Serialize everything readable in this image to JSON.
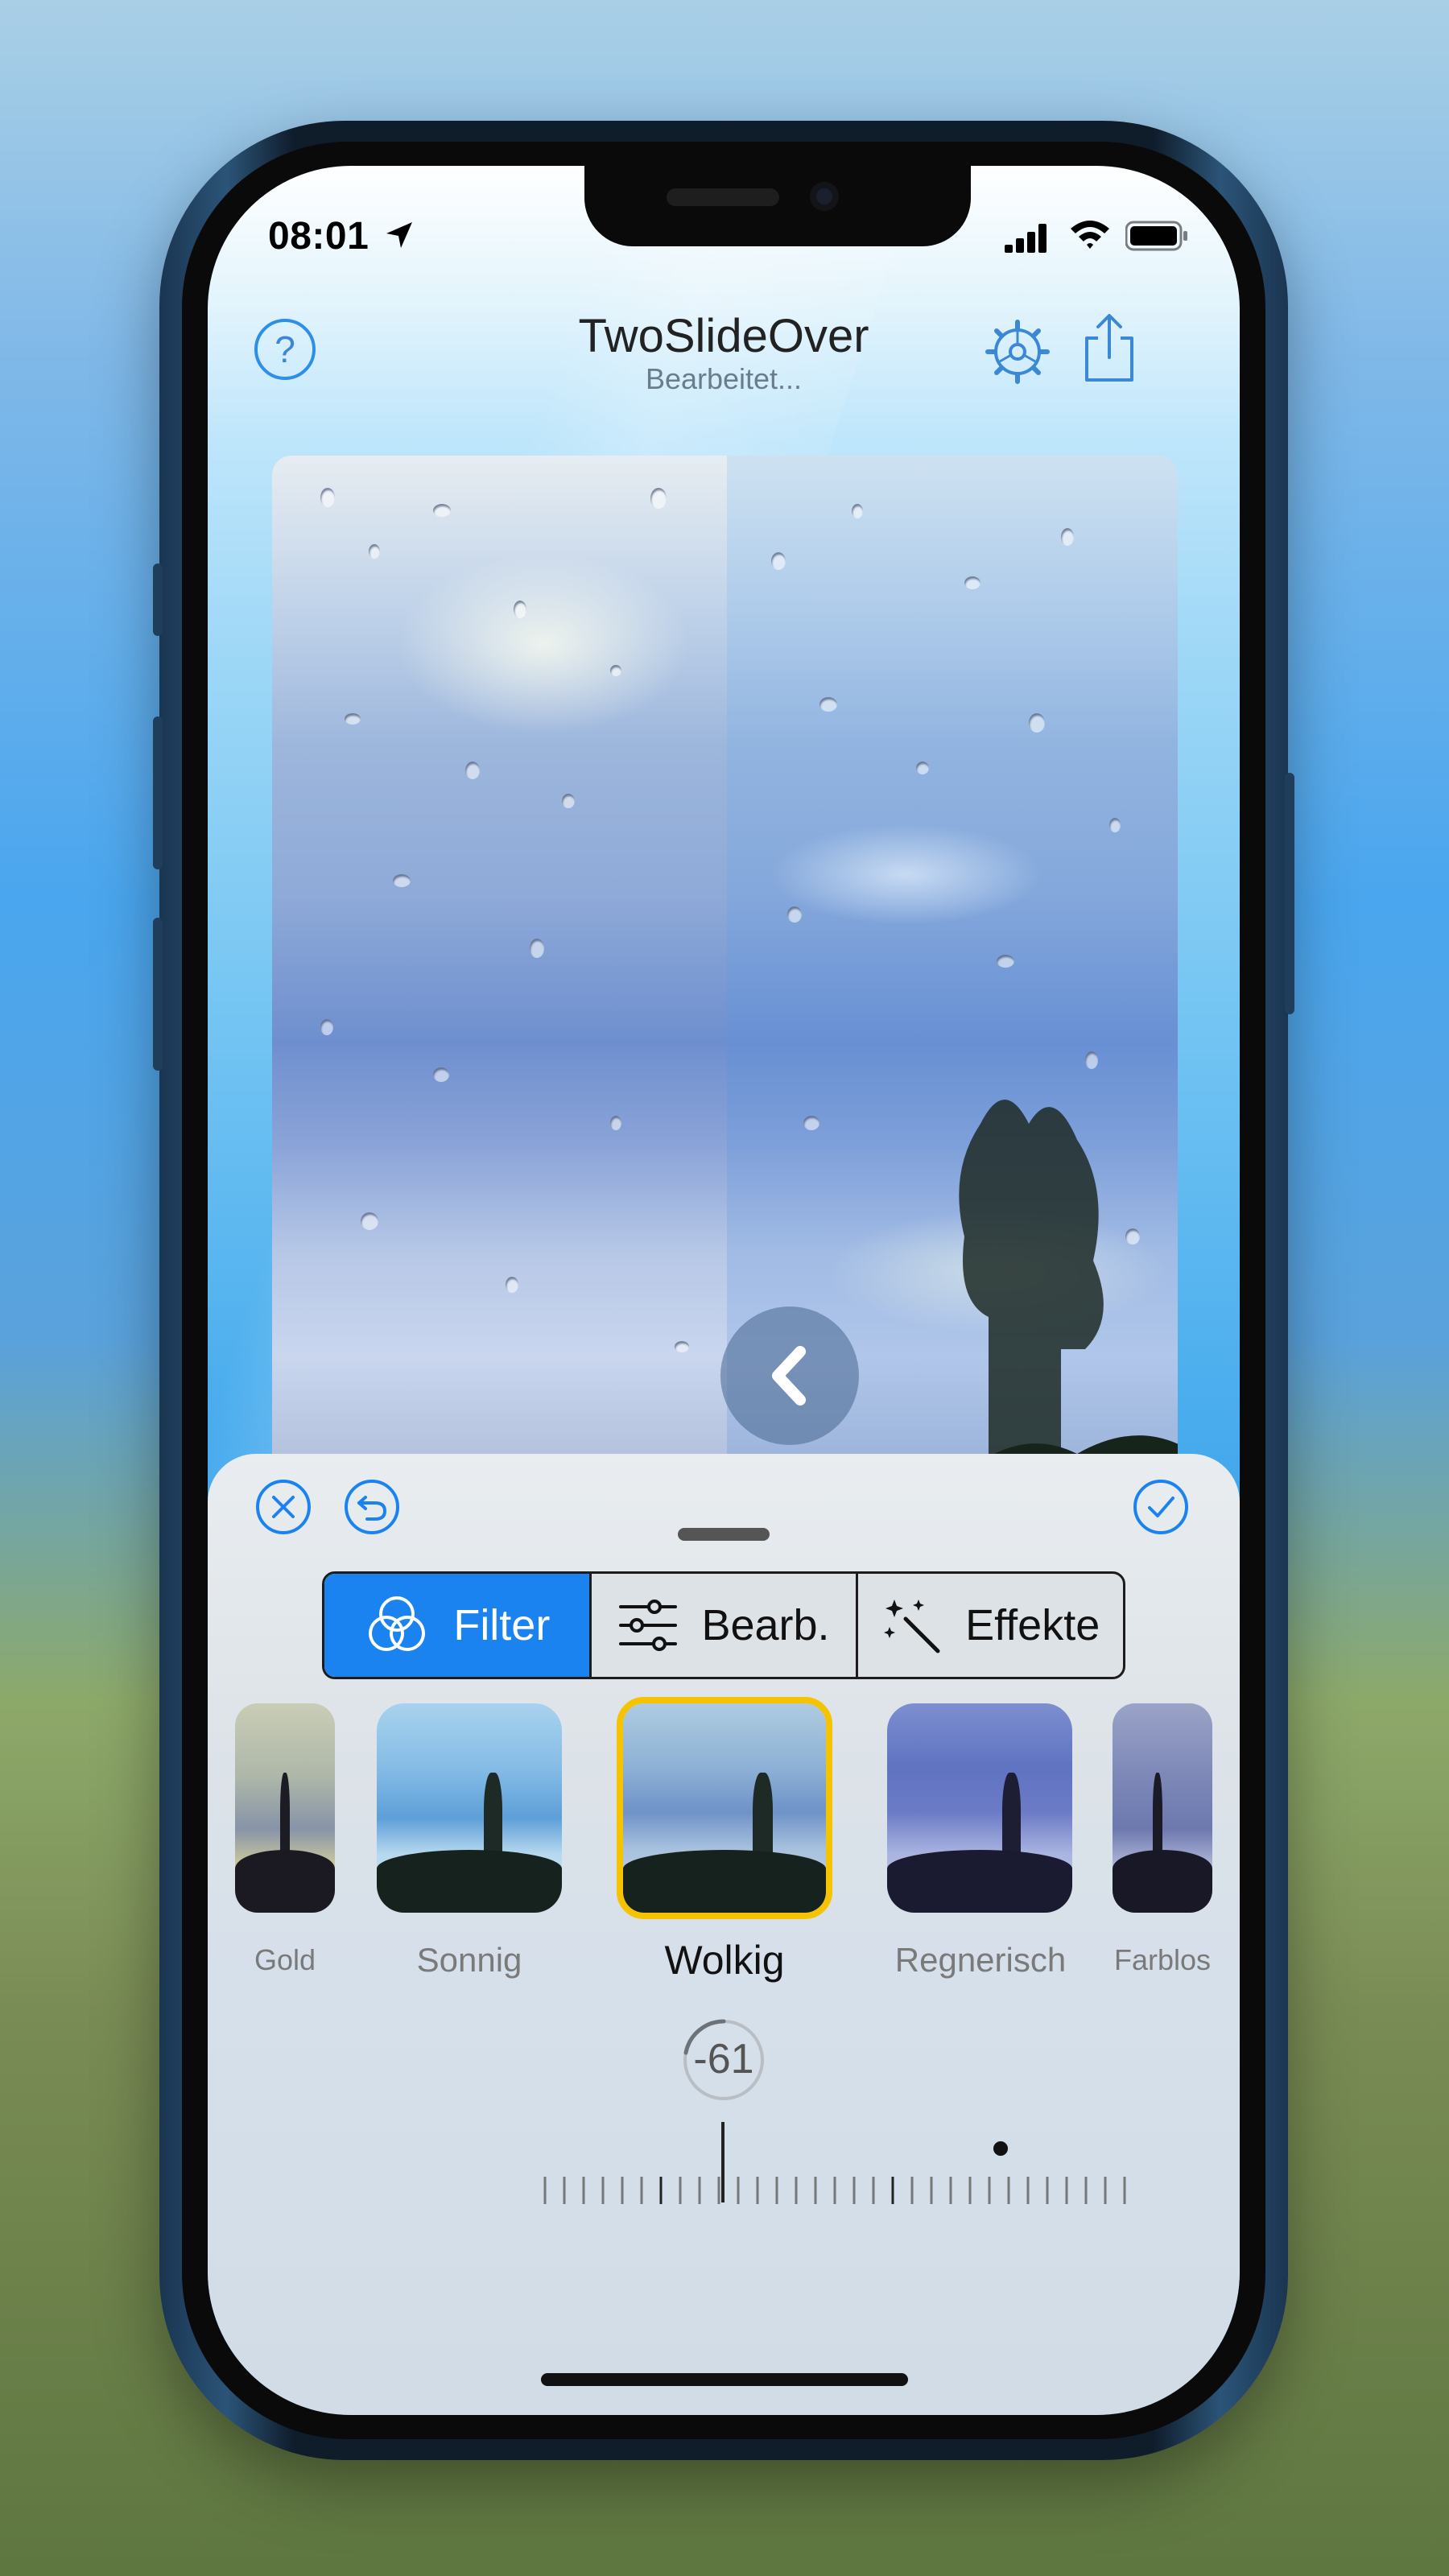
{
  "status_bar": {
    "time": "08:01"
  },
  "nav": {
    "title": "TwoSlideOver",
    "subtitle": "Bearbeitet...",
    "help_symbol": "?"
  },
  "tabs": [
    {
      "label": "Filter",
      "icon": "filter-circles-icon",
      "active": true
    },
    {
      "label": "Bearb.",
      "icon": "sliders-icon",
      "active": false
    },
    {
      "label": "Effekte",
      "icon": "magic-wand-icon",
      "active": false
    }
  ],
  "filters": [
    {
      "label": "Gold",
      "selected": false
    },
    {
      "label": "Sonnig",
      "selected": false
    },
    {
      "label": "Wolkig",
      "selected": true
    },
    {
      "label": "Regnerisch",
      "selected": false
    },
    {
      "label": "Farblos",
      "selected": false
    }
  ],
  "slider": {
    "value": "-61"
  },
  "colors": {
    "accent": "#1a83f0",
    "selection": "#f5c300"
  }
}
